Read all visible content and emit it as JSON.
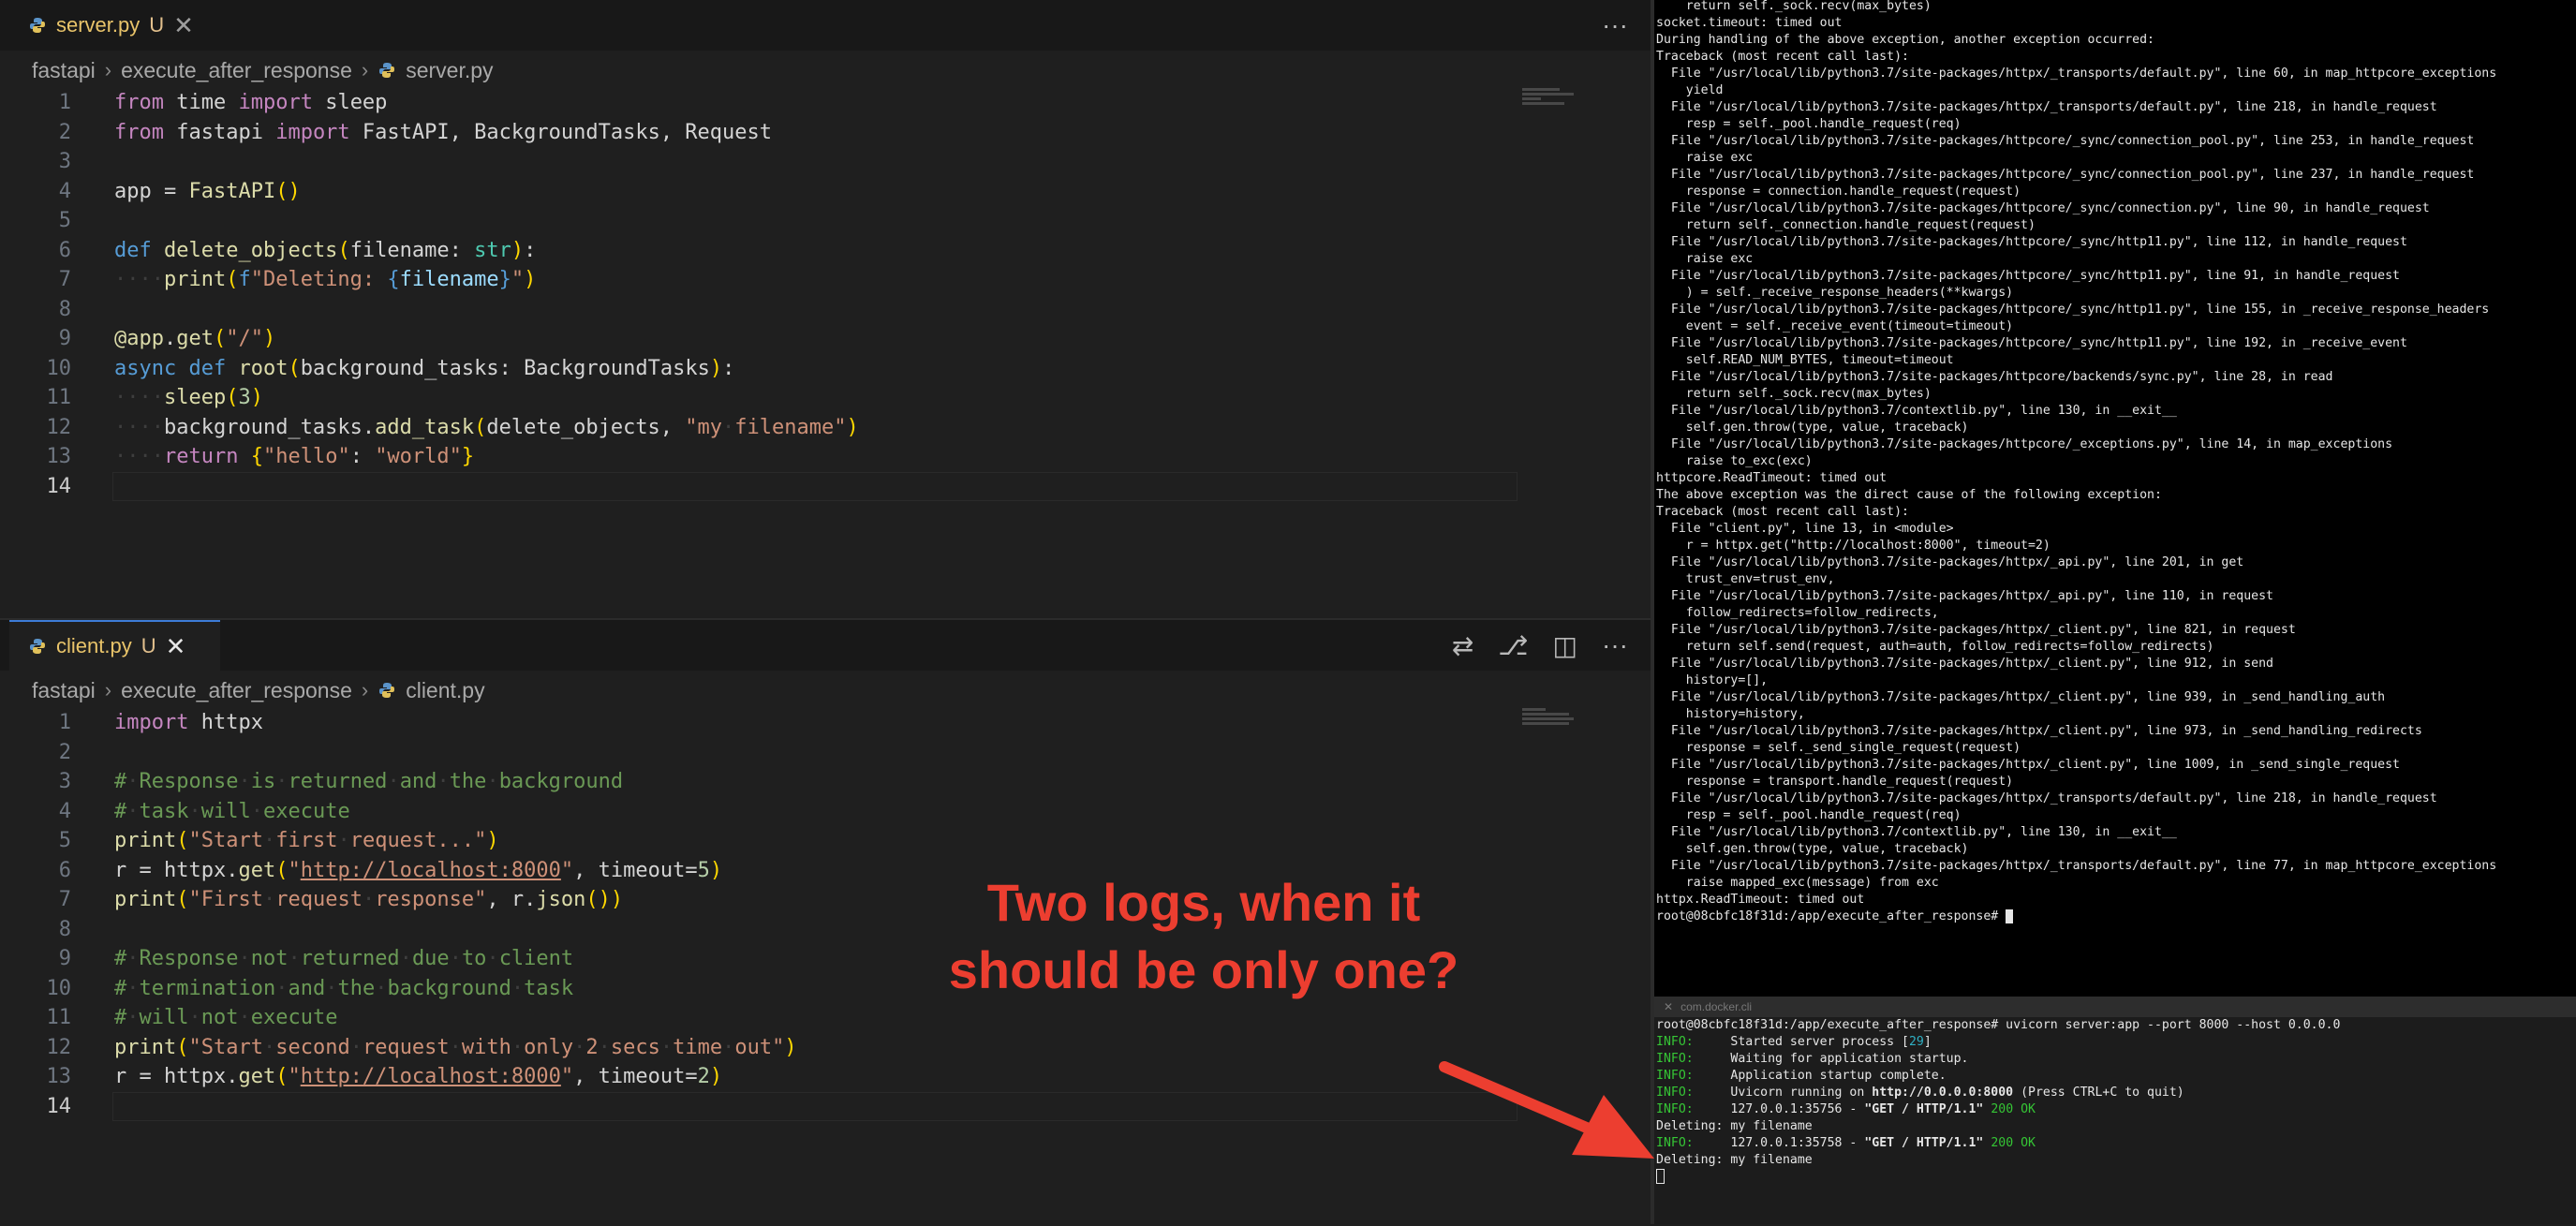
{
  "top_editor": {
    "tab": {
      "filename": "server.py",
      "status": "U",
      "close": "✕"
    },
    "actions": {
      "more": "···"
    },
    "breadcrumb": [
      "fastapi",
      "execute_after_response",
      "server.py"
    ],
    "line_numbers": [
      "1",
      "2",
      "3",
      "4",
      "5",
      "6",
      "7",
      "8",
      "9",
      "10",
      "11",
      "12",
      "13",
      "14"
    ],
    "lines": [
      "from time import sleep",
      "from fastapi import FastAPI, BackgroundTasks, Request",
      "",
      "app = FastAPI()",
      "",
      "def delete_objects(filename: str):",
      "    print(f\"Deleting: {filename}\")",
      "",
      "@app.get(\"/\")",
      "async def root(background_tasks: BackgroundTasks):",
      "    sleep(3)",
      "    background_tasks.add_task(delete_objects, \"my filename\")",
      "    return {\"hello\": \"world\"}",
      ""
    ]
  },
  "bottom_editor": {
    "tab": {
      "filename": "client.py",
      "status": "U",
      "close": "✕"
    },
    "actions": {
      "compare": "⇄",
      "source_control": "⎇",
      "split": "◫",
      "more": "···"
    },
    "breadcrumb": [
      "fastapi",
      "execute_after_response",
      "client.py"
    ],
    "line_numbers": [
      "1",
      "2",
      "3",
      "4",
      "5",
      "6",
      "7",
      "8",
      "9",
      "10",
      "11",
      "12",
      "13",
      "14"
    ],
    "lines": [
      "import httpx",
      "",
      "# Response is returned and the background",
      "# task will execute",
      "print(\"Start first request...\")",
      "r = httpx.get(\"http://localhost:8000\", timeout=5)",
      "print(\"First request response\", r.json())",
      "",
      "# Response not returned due to client",
      "# termination and the background task",
      "# will not execute",
      "print(\"Start second request with only 2 secs time out\")",
      "r = httpx.get(\"http://localhost:8000\", timeout=2)",
      ""
    ]
  },
  "terminal": {
    "lines": [
      "    return self._sock.recv(max_bytes)",
      "socket.timeout: timed out",
      "",
      "During handling of the above exception, another exception occurred:",
      "",
      "Traceback (most recent call last):",
      "  File \"/usr/local/lib/python3.7/site-packages/httpx/_transports/default.py\", line 60, in map_httpcore_exceptions",
      "    yield",
      "  File \"/usr/local/lib/python3.7/site-packages/httpx/_transports/default.py\", line 218, in handle_request",
      "    resp = self._pool.handle_request(req)",
      "  File \"/usr/local/lib/python3.7/site-packages/httpcore/_sync/connection_pool.py\", line 253, in handle_request",
      "    raise exc",
      "  File \"/usr/local/lib/python3.7/site-packages/httpcore/_sync/connection_pool.py\", line 237, in handle_request",
      "    response = connection.handle_request(request)",
      "  File \"/usr/local/lib/python3.7/site-packages/httpcore/_sync/connection.py\", line 90, in handle_request",
      "    return self._connection.handle_request(request)",
      "  File \"/usr/local/lib/python3.7/site-packages/httpcore/_sync/http11.py\", line 112, in handle_request",
      "    raise exc",
      "  File \"/usr/local/lib/python3.7/site-packages/httpcore/_sync/http11.py\", line 91, in handle_request",
      "    ) = self._receive_response_headers(**kwargs)",
      "  File \"/usr/local/lib/python3.7/site-packages/httpcore/_sync/http11.py\", line 155, in _receive_response_headers",
      "    event = self._receive_event(timeout=timeout)",
      "  File \"/usr/local/lib/python3.7/site-packages/httpcore/_sync/http11.py\", line 192, in _receive_event",
      "    self.READ_NUM_BYTES, timeout=timeout",
      "  File \"/usr/local/lib/python3.7/site-packages/httpcore/backends/sync.py\", line 28, in read",
      "    return self._sock.recv(max_bytes)",
      "  File \"/usr/local/lib/python3.7/contextlib.py\", line 130, in __exit__",
      "    self.gen.throw(type, value, traceback)",
      "  File \"/usr/local/lib/python3.7/site-packages/httpcore/_exceptions.py\", line 14, in map_exceptions",
      "    raise to_exc(exc)",
      "httpcore.ReadTimeout: timed out",
      "",
      "The above exception was the direct cause of the following exception:",
      "",
      "Traceback (most recent call last):",
      "  File \"client.py\", line 13, in <module>",
      "    r = httpx.get(\"http://localhost:8000\", timeout=2)",
      "  File \"/usr/local/lib/python3.7/site-packages/httpx/_api.py\", line 201, in get",
      "    trust_env=trust_env,",
      "  File \"/usr/local/lib/python3.7/site-packages/httpx/_api.py\", line 110, in request",
      "    follow_redirects=follow_redirects,",
      "  File \"/usr/local/lib/python3.7/site-packages/httpx/_client.py\", line 821, in request",
      "    return self.send(request, auth=auth, follow_redirects=follow_redirects)",
      "  File \"/usr/local/lib/python3.7/site-packages/httpx/_client.py\", line 912, in send",
      "    history=[],",
      "  File \"/usr/local/lib/python3.7/site-packages/httpx/_client.py\", line 939, in _send_handling_auth",
      "    history=history,",
      "  File \"/usr/local/lib/python3.7/site-packages/httpx/_client.py\", line 973, in _send_handling_redirects",
      "    response = self._send_single_request(request)",
      "  File \"/usr/local/lib/python3.7/site-packages/httpx/_client.py\", line 1009, in _send_single_request",
      "    response = transport.handle_request(request)",
      "  File \"/usr/local/lib/python3.7/site-packages/httpx/_transports/default.py\", line 218, in handle_request",
      "    resp = self._pool.handle_request(req)",
      "  File \"/usr/local/lib/python3.7/contextlib.py\", line 130, in __exit__",
      "    self.gen.throw(type, value, traceback)",
      "  File \"/usr/local/lib/python3.7/site-packages/httpx/_transports/default.py\", line 77, in map_httpcore_exceptions",
      "    raise mapped_exc(message) from exc",
      "httpx.ReadTimeout: timed out",
      "root@08cbfc18f31d:/app/execute_after_response# "
    ]
  },
  "server_terminal": {
    "tab_label": "com.docker.cli",
    "prompt_line": "root@08cbfc18f31d:/app/execute_after_response# uvicorn server:app --port 8000 --host 0.0.0.0",
    "info_label": "INFO:",
    "entries": [
      {
        "kind": "info",
        "text": "Started server process [",
        "pid": "29",
        "after": "]"
      },
      {
        "kind": "info",
        "text": "Waiting for application startup."
      },
      {
        "kind": "info",
        "text": "Application startup complete."
      },
      {
        "kind": "info",
        "text": "Uvicorn running on ",
        "bold": "http://0.0.0.0:8000",
        "after": " (Press CTRL+C to quit)"
      },
      {
        "kind": "info",
        "text": "127.0.0.1:35756 - ",
        "bold": "\"GET / HTTP/1.1\"",
        "status": " 200 OK"
      },
      {
        "kind": "plain",
        "text": "Deleting: my filename"
      },
      {
        "kind": "info",
        "text": "127.0.0.1:35758 - ",
        "bold": "\"GET / HTTP/1.1\"",
        "status": " 200 OK"
      },
      {
        "kind": "plain",
        "text": "Deleting: my filename"
      }
    ]
  },
  "annotation": {
    "line1": "Two logs, when it",
    "line2": "should be only one?",
    "color": "#ec3e30"
  }
}
